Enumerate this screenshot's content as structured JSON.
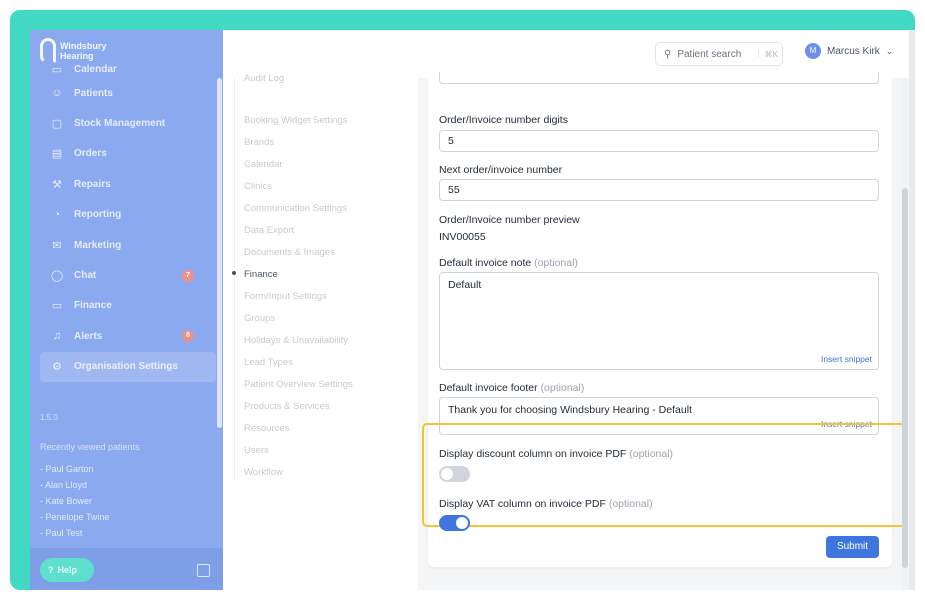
{
  "app": {
    "logo_line1": "Windsbury",
    "logo_line2": "Hearing",
    "version": "1.5.0"
  },
  "colors": {
    "frame": "#41d9c4",
    "sidebar": "#8aa9ef",
    "accent": "#3f76dd",
    "highlight": "#f3c631"
  },
  "sidebar": {
    "items": [
      {
        "label": "Calendar",
        "icon": "calendar-icon"
      },
      {
        "label": "Patients",
        "icon": "user-icon"
      },
      {
        "label": "Stock Management",
        "icon": "clipboard-icon"
      },
      {
        "label": "Orders",
        "icon": "orders-icon"
      },
      {
        "label": "Repairs",
        "icon": "wrench-icon"
      },
      {
        "label": "Reporting",
        "icon": "chart-icon"
      },
      {
        "label": "Marketing",
        "icon": "mail-icon"
      },
      {
        "label": "Chat",
        "icon": "chat-icon",
        "badge": "7"
      },
      {
        "label": "Finance",
        "icon": "card-icon"
      },
      {
        "label": "Alerts",
        "icon": "bell-icon",
        "badge": "8"
      },
      {
        "label": "Organisation Settings",
        "icon": "gear-icon"
      }
    ],
    "recent_title": "Recently viewed patients",
    "recent": [
      "- Paul Garton",
      "- Alan Lloyd",
      "- Kate Bower",
      "- Penelope Twine",
      "- Paul Test"
    ],
    "help_label": "Help"
  },
  "topbar": {
    "search_label": "Patient search",
    "search_shortcut": "⌘K",
    "user_initial": "M",
    "user_name": "Marcus Kirk"
  },
  "settings_nav": {
    "items": [
      "Audit Log",
      "Booking Widget Settings",
      "Brands",
      "Calendar",
      "Clinics",
      "Communication Settings",
      "Data Export",
      "Documents & Images",
      "Finance",
      "Form/Input Settings",
      "Groups",
      "Holidays & Unavailability",
      "Lead Types",
      "Patient Overview Settings",
      "Products & Services",
      "Resources",
      "Users",
      "Workflow"
    ],
    "active": "Finance"
  },
  "form": {
    "digits_label": "Order/Invoice number digits",
    "digits_value": "5",
    "next_label": "Next order/invoice number",
    "next_value": "55",
    "preview_label": "Order/Invoice number preview",
    "preview_value": "INV00055",
    "note_label": "Default invoice note",
    "note_value": "Default",
    "footer_label": "Default invoice footer",
    "footer_value": "Thank you for choosing Windsbury Hearing - Default",
    "optional": "(optional)",
    "insert_snippet": "Insert snippet",
    "discount_label": "Display discount column on invoice PDF",
    "discount_on": false,
    "vat_label": "Display VAT column on invoice PDF",
    "vat_on": true,
    "submit_label": "Submit"
  }
}
